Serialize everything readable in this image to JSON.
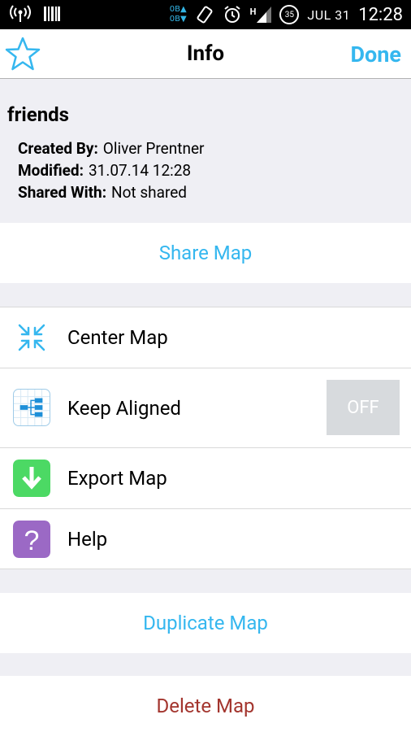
{
  "status_bar": {
    "net_up": "0B▲",
    "net_down": "0B▼",
    "h_label": "H",
    "battery": "35",
    "date": "JUL 31",
    "time": "12:28"
  },
  "nav": {
    "title": "Info",
    "done_label": "Done",
    "star_icon": "star-outline-icon",
    "accent": "#35b7ef"
  },
  "map": {
    "name": "friends",
    "created_by_key": "Created By:",
    "created_by_value": "Oliver Prentner",
    "modified_key": "Modified:",
    "modified_value": "31.07.14 12:28",
    "shared_key": "Shared With:",
    "shared_value": "Not shared"
  },
  "actions": {
    "share": "Share Map",
    "duplicate": "Duplicate Map",
    "delete": "Delete Map",
    "delete_color": "#a3352e"
  },
  "menu": [
    {
      "label": "Center Map",
      "icon": "center-map-icon"
    },
    {
      "label": "Keep Aligned",
      "icon": "keep-aligned-icon",
      "toggle": "OFF"
    },
    {
      "label": "Export Map",
      "icon": "export-download-icon"
    },
    {
      "label": "Help",
      "icon": "help-question-icon"
    }
  ]
}
